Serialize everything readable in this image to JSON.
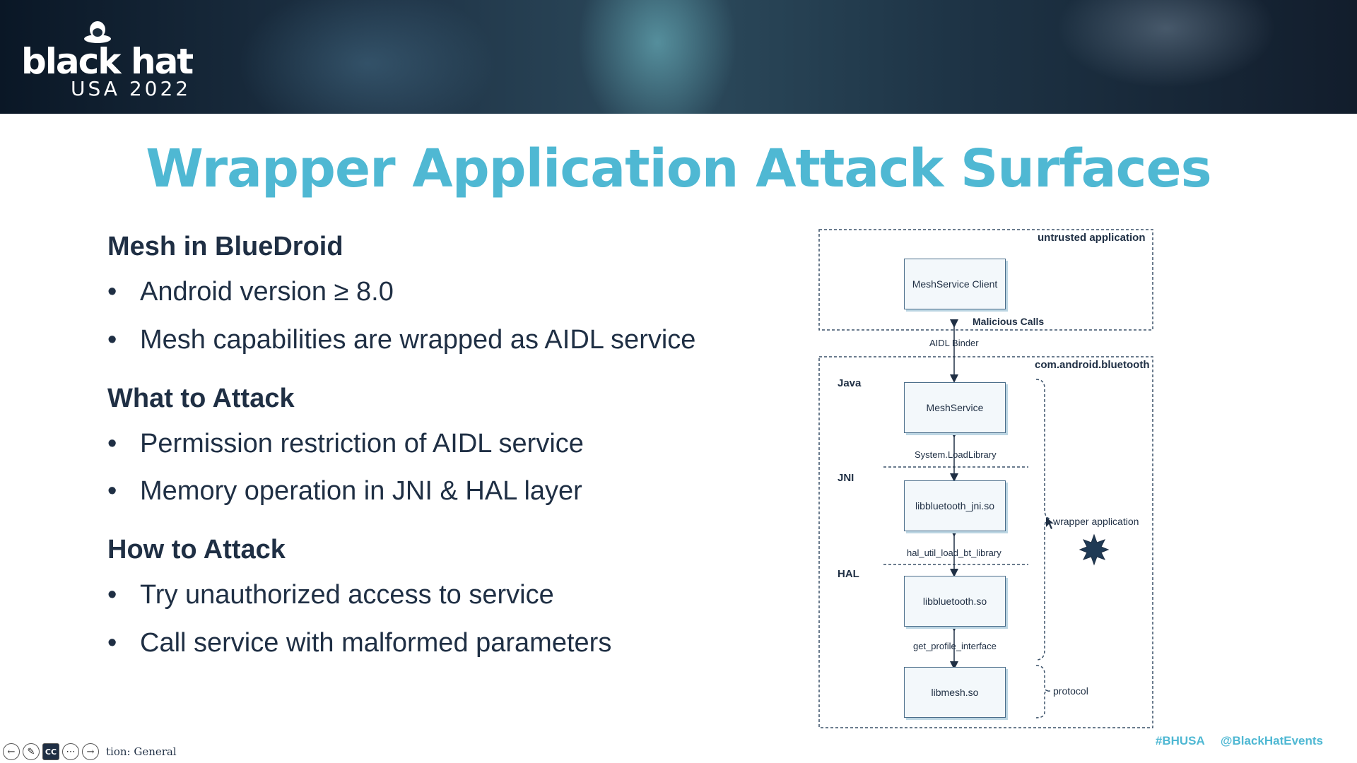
{
  "header": {
    "logo_main": "black hat",
    "logo_sub": "USA 2022"
  },
  "title": "Wrapper Application Attack Surfaces",
  "sections": [
    {
      "heading": "Mesh in BlueDroid",
      "bullets": [
        "Android version ≥ 8.0",
        "Mesh capabilities are wrapped as AIDL service"
      ]
    },
    {
      "heading": "What to Attack",
      "bullets": [
        "Permission restriction of AIDL service",
        "Memory operation in JNI & HAL layer"
      ]
    },
    {
      "heading": "How to Attack",
      "bullets": [
        "Try unauthorized access to service",
        "Call service with malformed parameters"
      ]
    }
  ],
  "bullet_glyph": "•",
  "diagram": {
    "untrusted_label": "untrusted application",
    "bluetooth_label": "com.android.bluetooth",
    "layer_java": "Java",
    "layer_jni": "JNI",
    "layer_hal": "HAL",
    "box_client": "MeshService Client",
    "box_service": "MeshService",
    "box_jni": "libbluetooth_jni.so",
    "box_bt": "libbluetooth.so",
    "box_mesh": "libmesh.so",
    "arrow_malicious": "Malicious Calls",
    "arrow_aidl": "AIDL Binder",
    "arrow_loadlib": "System.LoadLibrary",
    "arrow_hal_load": "hal_util_load_bt_library",
    "arrow_profile": "get_profile_interface",
    "brace_wrapper": "wrapper application",
    "brace_protocol": "protocol"
  },
  "footer": {
    "hashtag": "#BHUSA",
    "handle": "@BlackHatEvents",
    "classification": "tion: General",
    "cc_label": "CC"
  },
  "colors": {
    "accent": "#4fb8d3",
    "text_dark": "#1f2f44"
  }
}
